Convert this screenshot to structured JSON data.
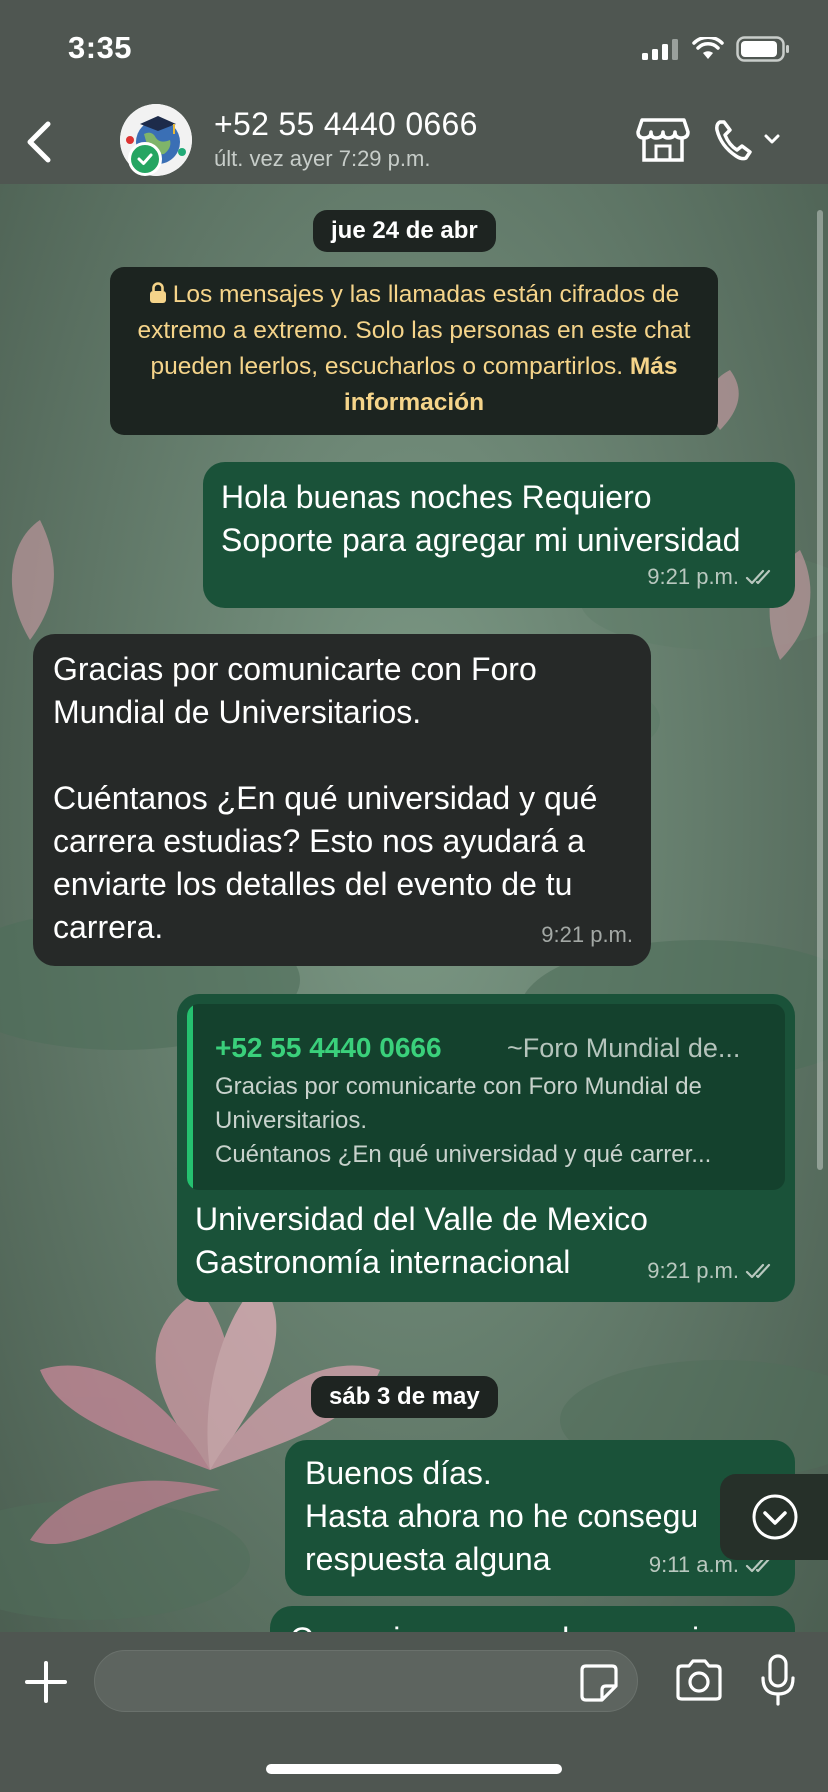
{
  "status_bar": {
    "time": "3:35"
  },
  "header": {
    "contact_name": "+52 55 4440 0666",
    "last_seen": "últ. vez ayer 7:29 p.m."
  },
  "chat": {
    "date_1": "jue 24 de abr",
    "notice_text": "Los mensajes y las llamadas están cifrados de extremo a extremo. Solo las personas en este chat pueden leerlos, escucharlos o compartirlos.",
    "notice_link": "Más información",
    "messages": [
      {
        "direction": "out",
        "lines": [
          "Hola buenas noches Requiero",
          "Soporte para agregar mi universidad"
        ],
        "time": "9:21 p.m.",
        "status": "read"
      },
      {
        "direction": "in",
        "lines": [
          "Gracias por comunicarte con Foro",
          "Mundial de Universitarios.",
          "",
          "Cuéntanos ¿En qué universidad y qué",
          "carrera estudias? Esto nos ayudará a",
          "enviarte los detalles del evento de tu",
          "carrera."
        ],
        "time": "9:21 p.m."
      },
      {
        "direction": "out",
        "quote": {
          "sender": "+52 55 4440 0666",
          "sender_tag": "~Foro Mundial de...",
          "lines": [
            "Gracias por comunicarte con Foro Mundial de",
            "Universitarios.",
            "Cuéntanos ¿En qué universidad y qué carrer..."
          ]
        },
        "lines": [
          "Universidad del Valle de Mexico",
          "Gastronomía internacional"
        ],
        "time": "9:21 p.m.",
        "status": "read"
      }
    ],
    "date_2": "sáb 3 de may",
    "messages_2": [
      {
        "direction": "out",
        "lines": [
          "Buenos días.",
          "Hasta ahora no he consegu",
          "respuesta alguna"
        ],
        "time": "9:11 a.m.",
        "status": "read"
      },
      {
        "direction": "out",
        "lines": [
          "Con quien me puedo comunicar"
        ]
      }
    ]
  },
  "composer": {
    "placeholder": "",
    "value": ""
  },
  "colors": {
    "outgoing": "#1a5239",
    "incoming": "#262928",
    "accent": "#25c16f",
    "notice_text": "#f5d48a"
  },
  "icons": [
    "back-chevron-icon",
    "store-icon",
    "phone-icon",
    "chevron-down-icon",
    "plus-icon",
    "sticker-icon",
    "camera-icon",
    "microphone-icon",
    "lock-icon",
    "double-check-icon",
    "scroll-down-icon"
  ]
}
